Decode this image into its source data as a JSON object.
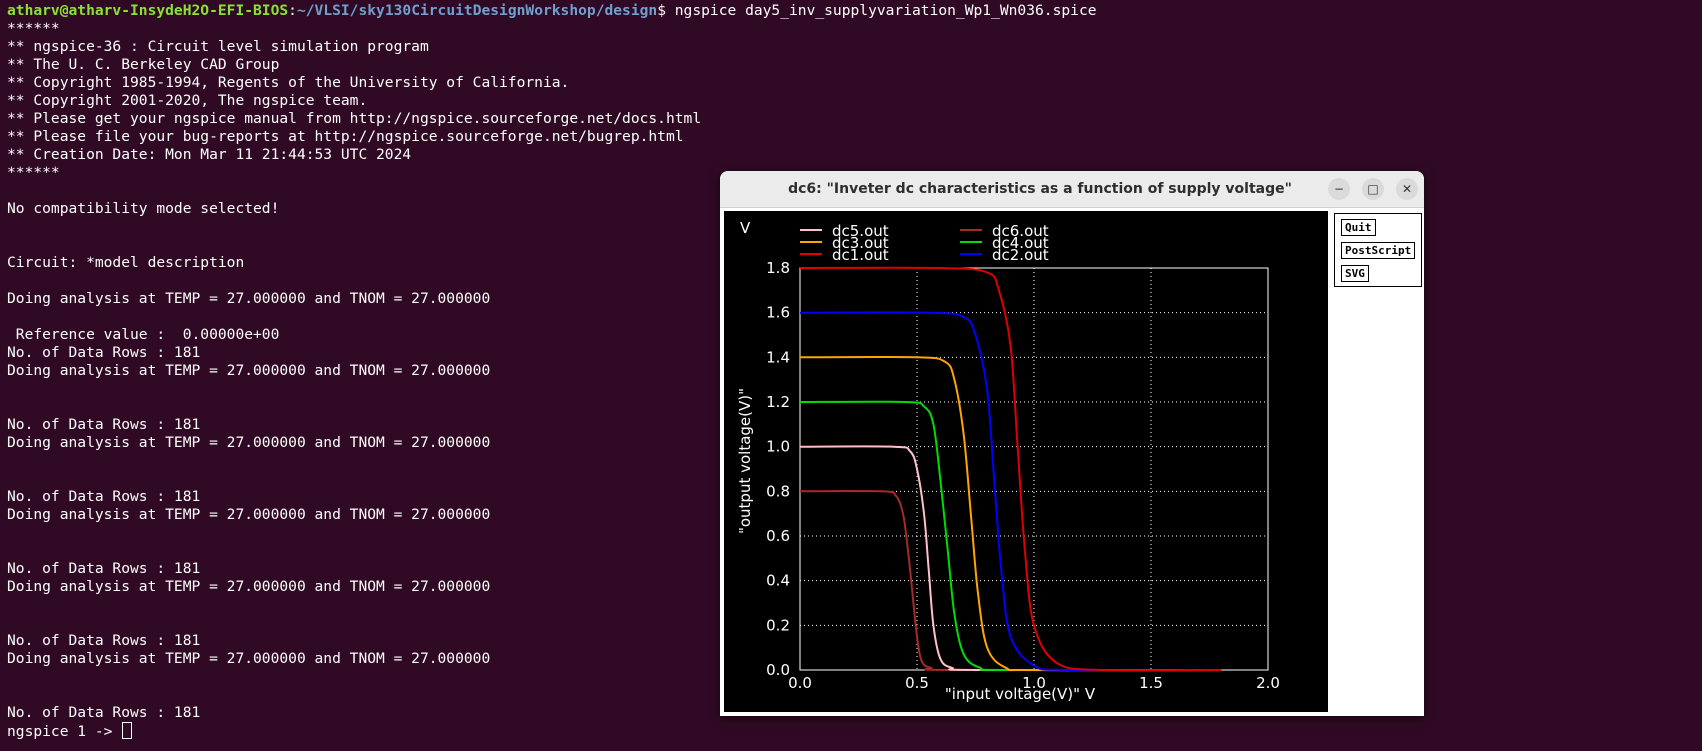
{
  "terminal": {
    "prompt_user": "atharv@atharv-InsydeH2O-EFI-BIOS",
    "prompt_sep": ":",
    "prompt_path": "~/VLSI/sky130CircuitDesignWorkshop/design",
    "prompt_command": "$ ngspice day5_inv_supplyvariation_Wp1_Wn036.spice",
    "lines": [
      "******",
      "** ngspice-36 : Circuit level simulation program",
      "** The U. C. Berkeley CAD Group",
      "** Copyright 1985-1994, Regents of the University of California.",
      "** Copyright 2001-2020, The ngspice team.",
      "** Please get your ngspice manual from http://ngspice.sourceforge.net/docs.html",
      "** Please file your bug-reports at http://ngspice.sourceforge.net/bugrep.html",
      "** Creation Date: Mon Mar 11 21:44:53 UTC 2024",
      "******",
      "",
      "No compatibility mode selected!",
      "",
      "",
      "Circuit: *model description",
      "",
      "Doing analysis at TEMP = 27.000000 and TNOM = 27.000000",
      "",
      " Reference value :  0.00000e+00",
      "No. of Data Rows : 181",
      "Doing analysis at TEMP = 27.000000 and TNOM = 27.000000",
      "",
      "",
      "No. of Data Rows : 181",
      "Doing analysis at TEMP = 27.000000 and TNOM = 27.000000",
      "",
      "",
      "No. of Data Rows : 181",
      "Doing analysis at TEMP = 27.000000 and TNOM = 27.000000",
      "",
      "",
      "No. of Data Rows : 181",
      "Doing analysis at TEMP = 27.000000 and TNOM = 27.000000",
      "",
      "",
      "No. of Data Rows : 181",
      "Doing analysis at TEMP = 27.000000 and TNOM = 27.000000",
      "",
      "",
      "No. of Data Rows : 181"
    ],
    "final_prompt": "ngspice 1 -> "
  },
  "plot_window": {
    "title": "dc6: \"Inveter dc characteristics as a function of supply voltage\"",
    "buttons": [
      "Quit",
      "PostScript",
      "SVG"
    ],
    "controls": {
      "minimize": "−",
      "maximize": "□",
      "close": "✕"
    }
  },
  "chart_data": {
    "type": "line",
    "ylabel": "\"output voltage(V)\"",
    "xlabel": "\"input voltage(V)\"  V",
    "y_unit_label": "V",
    "xlim": [
      0,
      2.0
    ],
    "ylim": [
      0,
      1.8
    ],
    "x_ticks": [
      "0.0",
      "0.5",
      "1.0",
      "1.5",
      "2.0"
    ],
    "y_ticks": [
      "0.0",
      "0.2",
      "0.4",
      "0.6",
      "0.8",
      "1.0",
      "1.2",
      "1.4",
      "1.6",
      "1.8"
    ],
    "grid": true,
    "legend_position": "top",
    "series": [
      {
        "name": "dc1.out",
        "color": "#e00000",
        "vdd": 1.8,
        "x": [
          0,
          0.6,
          0.8,
          0.85,
          0.9,
          0.93,
          0.96,
          1.0,
          1.1,
          1.3,
          1.8
        ],
        "y": [
          1.8,
          1.8,
          1.78,
          1.7,
          1.45,
          1.0,
          0.55,
          0.2,
          0.03,
          0,
          0
        ]
      },
      {
        "name": "dc2.out",
        "color": "#0000ff",
        "vdd": 1.6,
        "x": [
          0,
          0.55,
          0.7,
          0.75,
          0.8,
          0.83,
          0.86,
          0.9,
          1.0,
          1.15,
          1.8
        ],
        "y": [
          1.6,
          1.6,
          1.58,
          1.5,
          1.25,
          0.85,
          0.45,
          0.15,
          0.02,
          0,
          0
        ]
      },
      {
        "name": "dc3.out",
        "color": "#ffa500",
        "vdd": 1.4,
        "x": [
          0,
          0.5,
          0.62,
          0.66,
          0.7,
          0.73,
          0.76,
          0.8,
          0.88,
          1.0,
          1.8
        ],
        "y": [
          1.4,
          1.4,
          1.38,
          1.3,
          1.05,
          0.7,
          0.35,
          0.1,
          0.01,
          0,
          0
        ]
      },
      {
        "name": "dc4.out",
        "color": "#00dd00",
        "vdd": 1.2,
        "x": [
          0,
          0.45,
          0.53,
          0.57,
          0.6,
          0.63,
          0.66,
          0.7,
          0.77,
          0.88,
          1.8
        ],
        "y": [
          1.2,
          1.2,
          1.18,
          1.1,
          0.85,
          0.55,
          0.25,
          0.07,
          0.01,
          0,
          0
        ]
      },
      {
        "name": "dc5.out",
        "color": "#ffc0cb",
        "vdd": 1.0,
        "x": [
          0,
          0.4,
          0.47,
          0.5,
          0.53,
          0.55,
          0.57,
          0.6,
          0.65,
          0.75,
          1.8
        ],
        "y": [
          1.0,
          1.0,
          0.98,
          0.9,
          0.7,
          0.45,
          0.2,
          0.05,
          0.01,
          0,
          0
        ]
      },
      {
        "name": "dc6.out",
        "color": "#a52a2a",
        "vdd": 0.8,
        "x": [
          0,
          0.35,
          0.41,
          0.44,
          0.46,
          0.48,
          0.5,
          0.52,
          0.56,
          0.65,
          1.8
        ],
        "y": [
          0.8,
          0.8,
          0.78,
          0.7,
          0.55,
          0.35,
          0.15,
          0.04,
          0.01,
          0,
          0
        ]
      }
    ]
  }
}
